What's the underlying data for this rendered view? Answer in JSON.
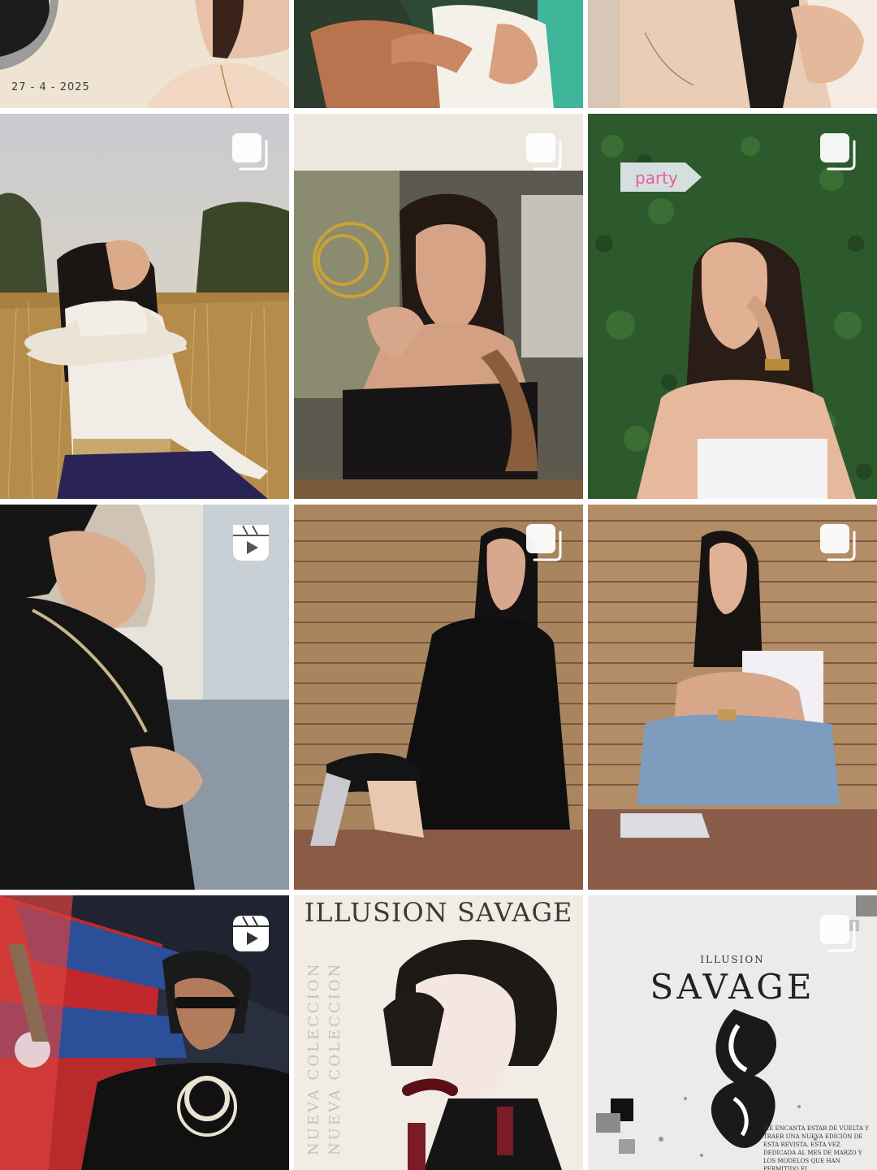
{
  "grid": {
    "background": "#ffffff",
    "badge_color": "#ffffff",
    "posts": [
      {
        "id": "post-1",
        "type": "image",
        "caption": "27 - 4 - 2025"
      },
      {
        "id": "post-2",
        "type": "image"
      },
      {
        "id": "post-3",
        "type": "image"
      },
      {
        "id": "post-4",
        "type": "carousel",
        "badge": "carousel-icon"
      },
      {
        "id": "post-5",
        "type": "carousel",
        "badge": "carousel-icon"
      },
      {
        "id": "post-6",
        "type": "carousel",
        "badge": "carousel-icon",
        "sign": "party"
      },
      {
        "id": "post-7",
        "type": "reel",
        "badge": "reels-icon"
      },
      {
        "id": "post-8",
        "type": "carousel",
        "badge": "carousel-icon"
      },
      {
        "id": "post-9",
        "type": "carousel",
        "badge": "carousel-icon"
      },
      {
        "id": "post-10",
        "type": "reel",
        "badge": "reels-icon"
      },
      {
        "id": "post-11",
        "type": "image",
        "title": "ILLUSION SAVAGE",
        "vertical_text": "NUEVA COLECCION"
      },
      {
        "id": "post-12",
        "type": "carousel",
        "badge": "carousel-icon",
        "small_title": "ILLUSION",
        "big_title": "SAVAGE",
        "body_text": "Me encanta estar de vuelta y traer una nueva edición de esta revista. Esta vez dedicada al mes de marzo y los modelos que han permitido el"
      }
    ]
  }
}
